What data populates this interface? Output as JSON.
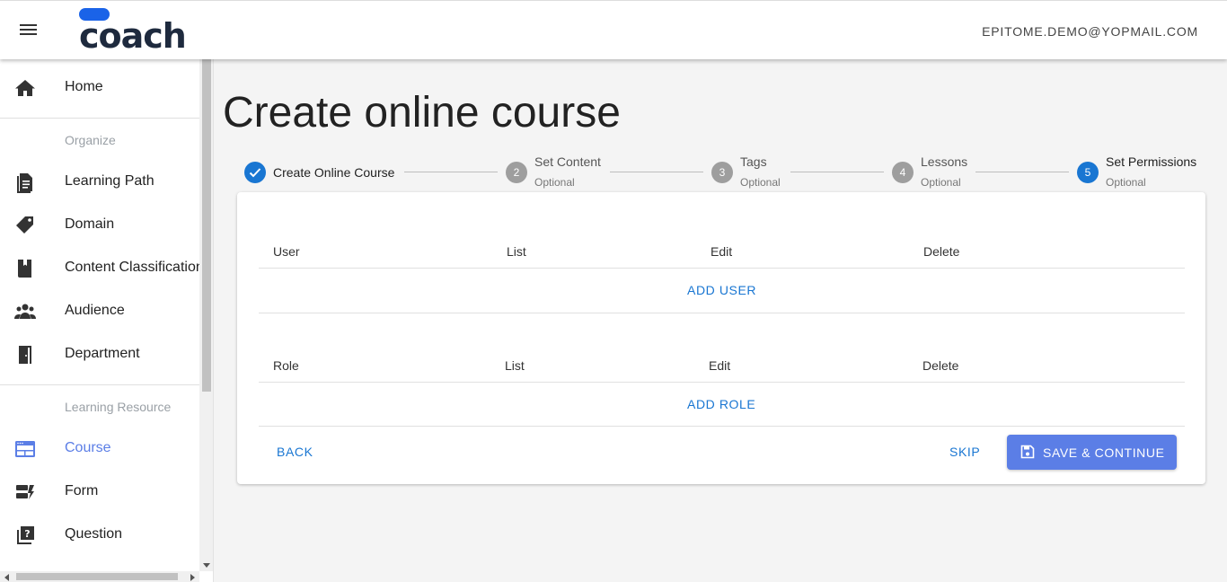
{
  "header": {
    "menu_icon": "hamburger-menu-icon",
    "logo_text": "coach",
    "brand_color": "#1a63e8",
    "user_email": "EPITOME.DEMO@YOPMAIL.COM"
  },
  "sidebar": {
    "home": {
      "label": "Home",
      "icon": "home-icon"
    },
    "section_organize": "Organize",
    "organize_items": [
      {
        "label": "Learning Path",
        "icon": "document-icon"
      },
      {
        "label": "Domain",
        "icon": "tag-icon"
      },
      {
        "label": "Content Classification",
        "icon": "book-icon"
      },
      {
        "label": "Audience",
        "icon": "group-icon"
      },
      {
        "label": "Department",
        "icon": "door-icon"
      }
    ],
    "section_resources": "Learning Resource",
    "resource_items": [
      {
        "label": "Course",
        "icon": "course-icon",
        "active": true
      },
      {
        "label": "Form",
        "icon": "form-icon"
      },
      {
        "label": "Question",
        "icon": "question-icon"
      }
    ],
    "active_color": "#5b7ee6"
  },
  "main": {
    "title": "Create online course",
    "steps": [
      {
        "number": "1",
        "title": "Create Online Course",
        "subtitle": "",
        "state": "completed"
      },
      {
        "number": "2",
        "title": "Set Content",
        "subtitle": "Optional",
        "state": "pending"
      },
      {
        "number": "3",
        "title": "Tags",
        "subtitle": "Optional",
        "state": "pending"
      },
      {
        "number": "4",
        "title": "Lessons",
        "subtitle": "Optional",
        "state": "pending"
      },
      {
        "number": "5",
        "title": "Set Permissions",
        "subtitle": "Optional",
        "state": "active"
      }
    ],
    "user_table": {
      "columns": [
        "User",
        "List",
        "Edit",
        "Delete"
      ],
      "add_label": "ADD USER"
    },
    "role_table": {
      "columns": [
        "Role",
        "List",
        "Edit",
        "Delete"
      ],
      "add_label": "ADD ROLE"
    },
    "actions": {
      "back": "BACK",
      "skip": "SKIP",
      "save": "SAVE & CONTINUE",
      "save_icon": "save-icon"
    }
  }
}
